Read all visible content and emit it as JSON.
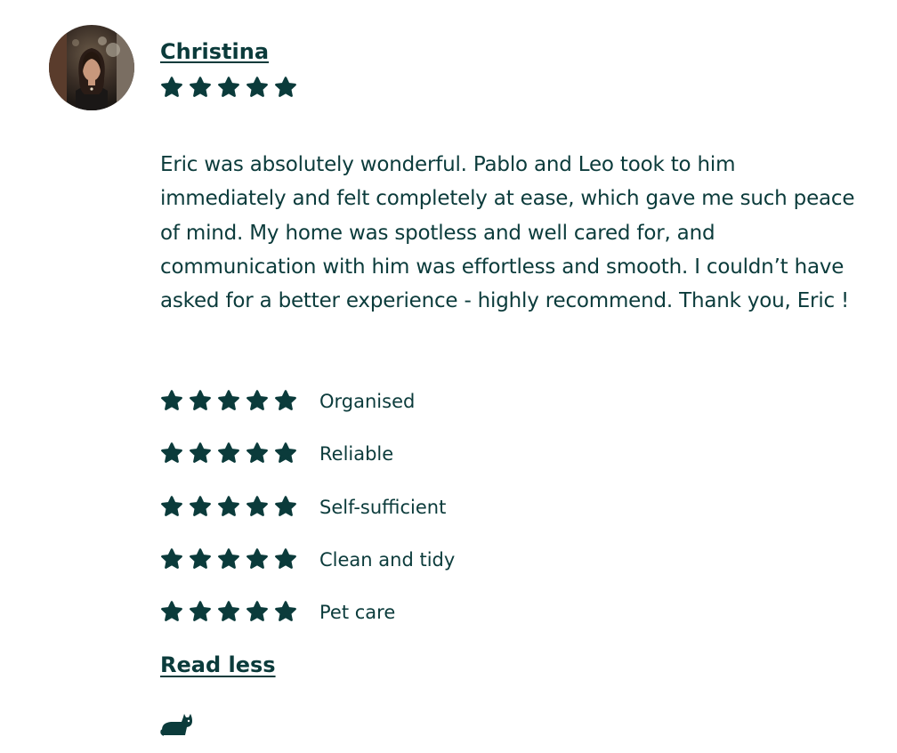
{
  "reviewer": {
    "name": "Christina",
    "avatar": "avatar-photo",
    "rating": 5
  },
  "review": {
    "text": "Eric was absolutely wonderful. Pablo and Leo took to him immediately and felt completely at ease, which gave me such peace of mind. My home was spotless and well cared for, and communication with him was effortless and smooth. I couldn’t have asked for a better experience - highly recommend. Thank you, Eric !"
  },
  "criteria": [
    {
      "label": "Organised",
      "rating": 5
    },
    {
      "label": "Reliable",
      "rating": 5
    },
    {
      "label": "Self-sufficient",
      "rating": 5
    },
    {
      "label": "Clean and tidy",
      "rating": 5
    },
    {
      "label": "Pet care",
      "rating": 5
    }
  ],
  "read_less_label": "Read less",
  "pet_icon": "cat-icon",
  "colors": {
    "text": "#0b3b3b",
    "star": "#0b3b3b",
    "background": "#ffffff"
  }
}
